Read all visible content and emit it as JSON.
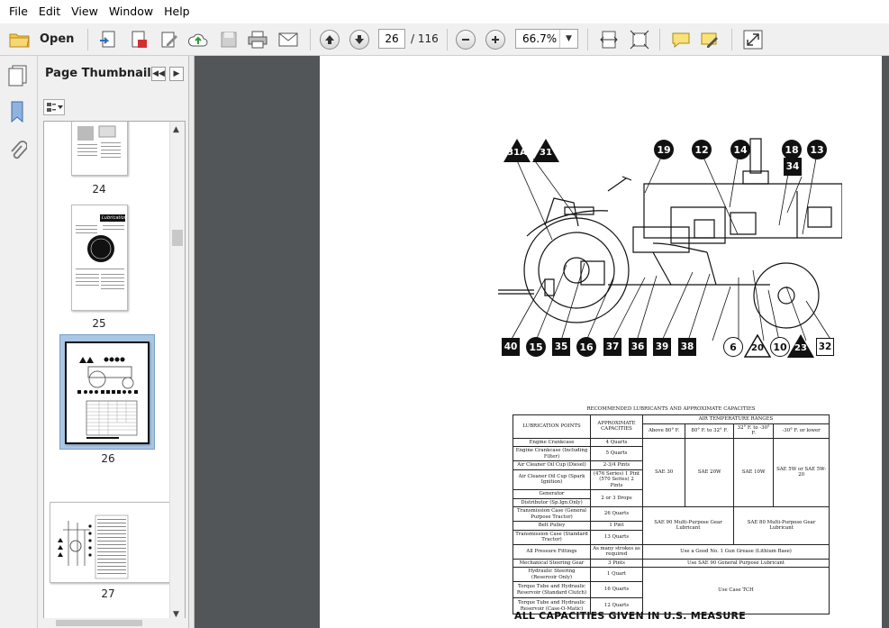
{
  "menu": [
    "File",
    "Edit",
    "View",
    "Window",
    "Help"
  ],
  "toolbar": {
    "open_label": "Open",
    "page_current": "26",
    "page_total": "/ 116",
    "zoom": "66.7%"
  },
  "panel": {
    "title": "Page Thumbnails"
  },
  "thumbnails": [
    {
      "label": "24",
      "mini_title": ""
    },
    {
      "label": "25",
      "mini_title": "Lubrication"
    },
    {
      "label": "26",
      "mini_title": ""
    },
    {
      "label": "27",
      "mini_title": ""
    }
  ],
  "diagram": {
    "callouts_top": [
      "31A",
      "31",
      "19",
      "12",
      "14",
      "18",
      "13",
      "34"
    ],
    "callouts_bottom": [
      "40",
      "15",
      "35",
      "16",
      "37",
      "36",
      "39",
      "38",
      "6",
      "20",
      "10",
      "23",
      "32"
    ]
  },
  "table": {
    "caption": "RECOMMENDED LUBRICANTS AND APPROXIMATE CAPACITIES",
    "col_points": "LUBRICATION POINTS",
    "col_capacity": "APPROXIMATE CAPACITIES",
    "col_temp": "AIR TEMPERATURE RANGES",
    "temps": [
      "Above 80° F.",
      "80° F. to 32° F.",
      "32° F. to -30° F.",
      "-30° F. or lower"
    ],
    "rows": [
      {
        "point": "Engine Crankcase",
        "cap": "4 Quarts"
      },
      {
        "point": "Engine Crankcase (Including Filter)",
        "cap": "5 Quarts"
      },
      {
        "point": "Air Cleaner Oil Cup (Diesel)",
        "cap": "2-3/4 Pints"
      },
      {
        "point": "Air Cleaner Oil Cup (Spark Ignition)",
        "cap": "(476 Series) 1 Pint (570 Series) 2 Pints"
      },
      {
        "point": "Generator",
        "cap": "2 or 3 Drops"
      },
      {
        "point": "Distributor (Sp.Ign.Only)",
        "cap": ""
      },
      {
        "point": "Transmission Case (General Purpose Tractor)",
        "cap": "26 Quarts"
      },
      {
        "point": "Belt Pulley",
        "cap": "1 Pint"
      },
      {
        "point": "Transmission Case (Standard Tractor)",
        "cap": "13 Quarts"
      },
      {
        "point": "All Pressure Fittings",
        "cap": "As many strokes as required"
      },
      {
        "point": "Mechanical Steering Gear",
        "cap": "3 Pints"
      },
      {
        "point": "Hydraulic Steering (Reservoir Only)",
        "cap": "1 Quart"
      },
      {
        "point": "Torque Tube and Hydraulic Reservoir (Standard Clutch)",
        "cap": "16 Quarts"
      },
      {
        "point": "Torque Tube and Hydraulic Reservoir (Case-O-Matic)",
        "cap": "12 Quarts"
      }
    ],
    "oil": [
      "SAE 30",
      "SAE 20W",
      "SAE 10W",
      "SAE 5W or SAE 5W-20"
    ],
    "gear_a": "SAE 90 Multi-Purpose Gear Lubricant",
    "gear_b": "SAE 80 Multi-Purpose Gear Lubricant",
    "grease": "Use a Good No. 1 Gun Grease (Lithium Base)",
    "steering": "Use SAE 90 General Purpose Lubricant",
    "tch": "Use Case TCH"
  },
  "footer": "ALL CAPACITIES GIVEN IN U.S. MEASURE"
}
